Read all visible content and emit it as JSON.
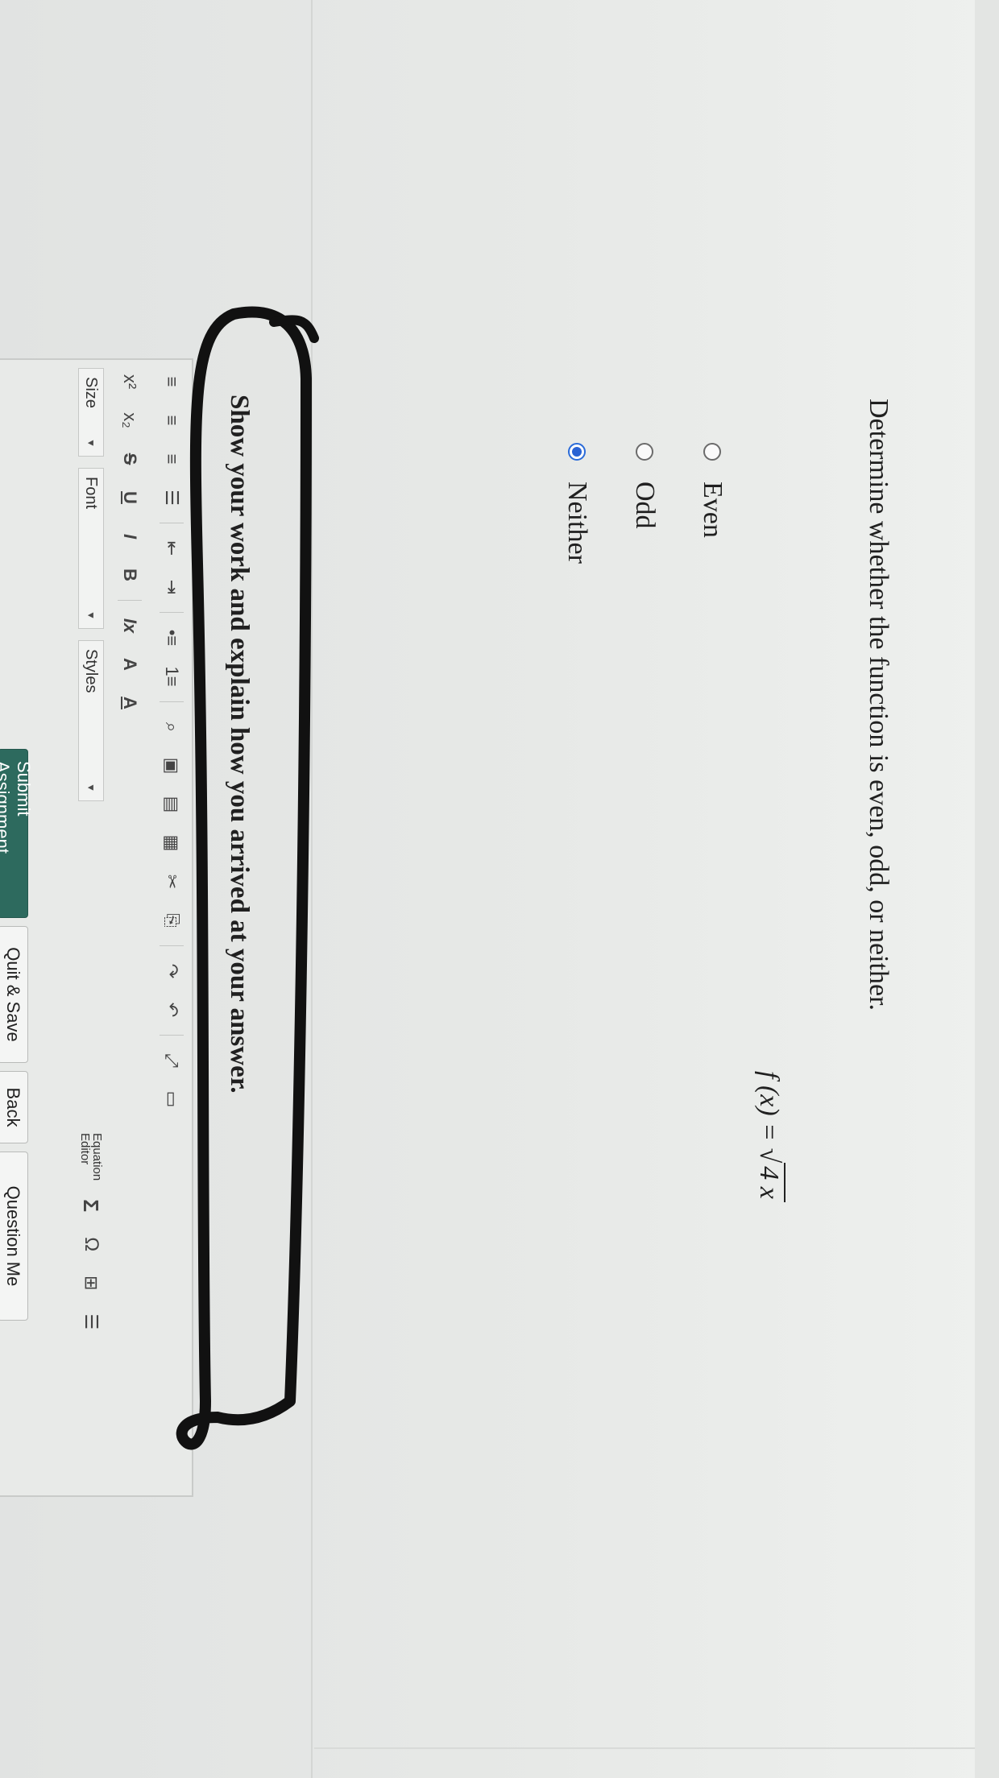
{
  "question": {
    "text": "Determine whether the function is even, odd, or neither.",
    "formula_lhs": "f (x) = ",
    "formula_radicand": "4 x",
    "options": [
      {
        "label": "Even",
        "selected": false
      },
      {
        "label": "Odd",
        "selected": false
      },
      {
        "label": "Neither",
        "selected": true
      }
    ]
  },
  "work": {
    "prompt": "Show your work and explain how you arrived at your answer."
  },
  "editor": {
    "styles_label": "Styles",
    "font_label": "Font",
    "size_label": "Size",
    "equation_editor_line1": "Equation",
    "equation_editor_line2": "Editor",
    "bold": "B",
    "italic": "I",
    "underline": "U",
    "strike": "S",
    "subscript": "x₂",
    "superscript": "x²",
    "text_color": "A",
    "bg_color": "A",
    "clear_format": "Ix",
    "omega": "Ω",
    "sigma": "Σ"
  },
  "footer": {
    "submit": "Submit Assignment",
    "quit": "Quit & Save",
    "back": "Back",
    "question_menu": "Question Me"
  },
  "colors": {
    "radio_selected": "#2a63d4",
    "submit_bg": "#2d6a5e",
    "annotation": "#111111"
  }
}
